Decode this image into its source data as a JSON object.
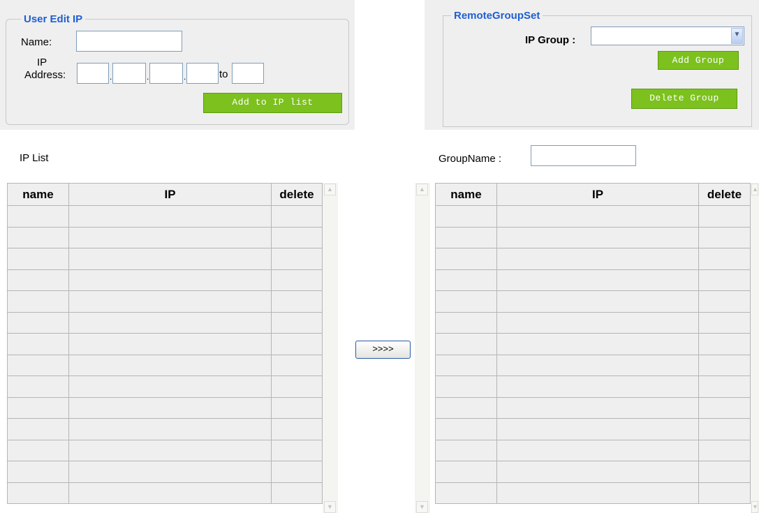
{
  "user_edit": {
    "legend": "User Edit IP",
    "name_label": "Name:",
    "name_value": "",
    "ip_label_1": "IP",
    "ip_label_2": "Address:",
    "ip_octets": [
      "",
      "",
      "",
      ""
    ],
    "to_label": "to",
    "ip_to_value": "",
    "add_button": "Add to IP list"
  },
  "remote_group": {
    "legend": "RemoteGroupSet",
    "ip_group_label": "IP Group :",
    "ip_group_selected": "",
    "add_group_button": "Add Group",
    "delete_group_button": "Delete Group"
  },
  "ip_list": {
    "title": "IP List",
    "columns": [
      "name",
      "IP",
      "delete"
    ],
    "row_count": 14
  },
  "group_list": {
    "groupname_label": "GroupName :",
    "groupname_value": "",
    "columns": [
      "name",
      "IP",
      "delete"
    ],
    "row_count": 14
  },
  "move_button": ">>>>"
}
